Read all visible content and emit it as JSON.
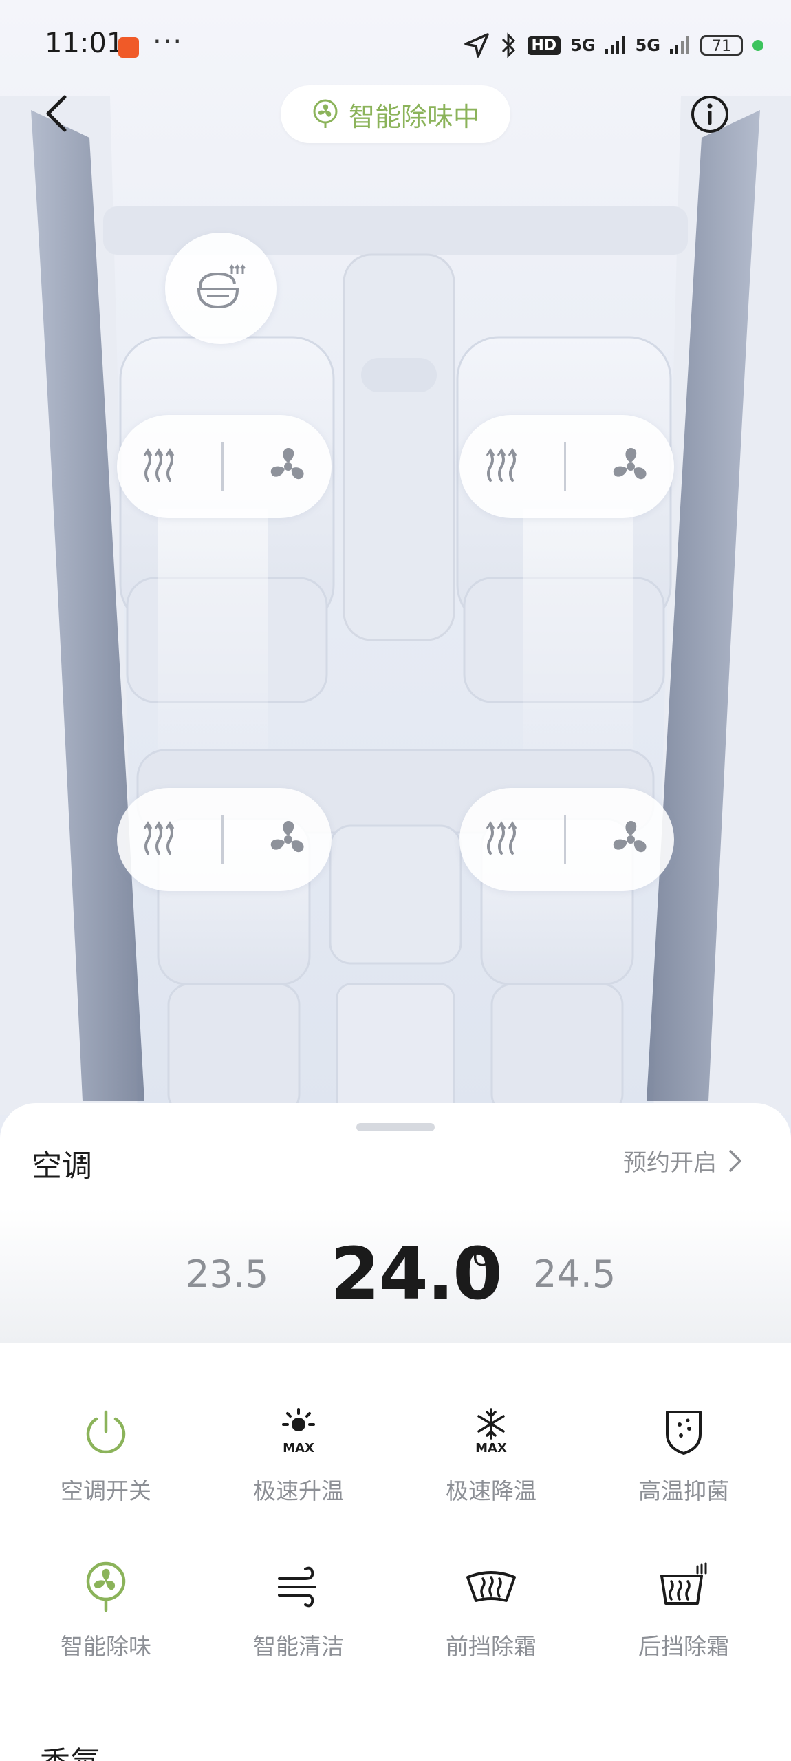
{
  "status_bar": {
    "time": "11:01",
    "dots": "···",
    "hd": "HD",
    "signal_1": "5G",
    "signal_2": "5G",
    "battery": "71"
  },
  "header": {
    "mode_label": "智能除味中"
  },
  "sheet": {
    "title": "空调",
    "schedule_label": "预约开启",
    "temp_low": "23.5",
    "temp_current": "24.0",
    "temp_unit": "°C",
    "temp_high": "24.5",
    "controls": [
      {
        "label": "空调开关",
        "icon": "power-icon",
        "active": true
      },
      {
        "label": "极速升温",
        "icon": "sun-max-icon",
        "active": false
      },
      {
        "label": "极速降温",
        "icon": "snowflake-max-icon",
        "active": false
      },
      {
        "label": "高温抑菌",
        "icon": "shield-icon",
        "active": false
      },
      {
        "label": "智能除味",
        "icon": "fan-icon",
        "active": true
      },
      {
        "label": "智能清洁",
        "icon": "wind-icon",
        "active": false
      },
      {
        "label": "前挡除霜",
        "icon": "front-defrost-icon",
        "active": false
      },
      {
        "label": "后挡除霜",
        "icon": "rear-defrost-icon",
        "active": false
      }
    ],
    "next_section": "香氛"
  },
  "colors": {
    "accent": "#8bb35a",
    "text_primary": "#1b1b1b",
    "text_secondary": "#8c8f95"
  }
}
